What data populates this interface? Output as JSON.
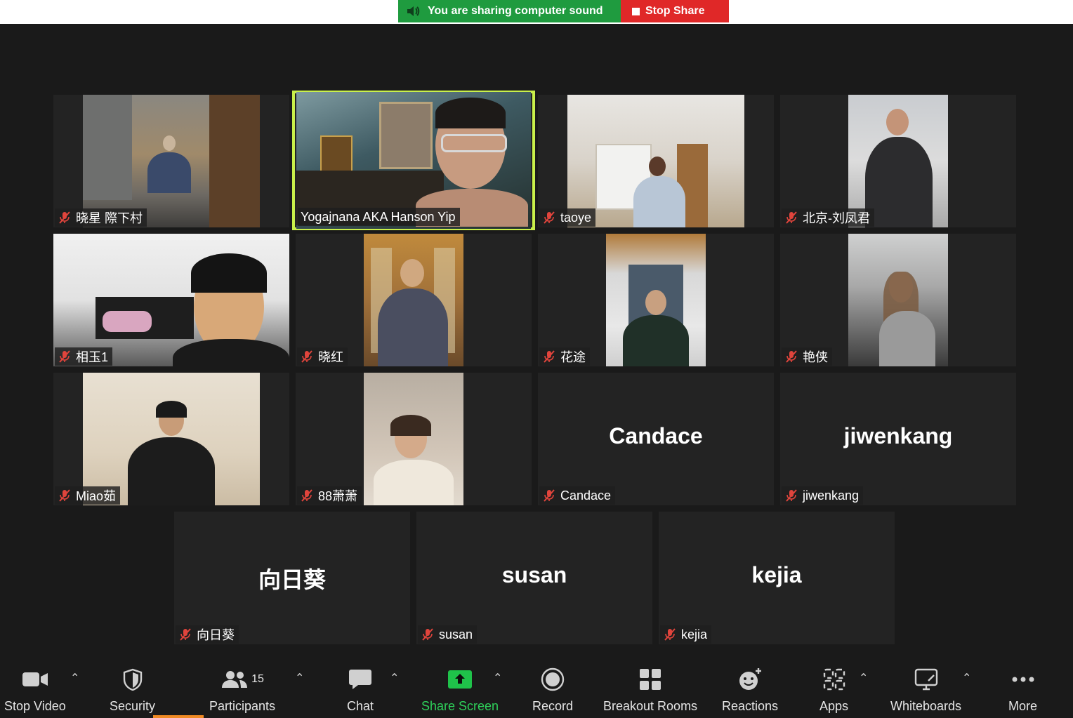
{
  "share_bar": {
    "sound_text": "You are sharing computer sound",
    "stop_text": "Stop Share"
  },
  "tiles": [
    {
      "name": "晓星 際下村",
      "video": true
    },
    {
      "name": "Yogajnana AKA Hanson Yip",
      "video": true,
      "active": true
    },
    {
      "name": "taoye",
      "video": true
    },
    {
      "name": "北京-刘凤君",
      "video": true
    },
    {
      "name": "相玉1",
      "video": true
    },
    {
      "name": "晓红",
      "video": true
    },
    {
      "name": "花途",
      "video": true
    },
    {
      "name": "艳侠",
      "video": true
    },
    {
      "name": "Miao茹",
      "video": true
    },
    {
      "name": "88萧萧",
      "video": true
    },
    {
      "name": "Candace",
      "big_name": "Candace",
      "video": false
    },
    {
      "name": "jiwenkang",
      "big_name": "jiwenkang",
      "video": false
    },
    {
      "name": "向日葵",
      "big_name": "向日葵",
      "video": false
    },
    {
      "name": "susan",
      "big_name": "susan",
      "video": false
    },
    {
      "name": "kejia",
      "big_name": "kejia",
      "video": false
    }
  ],
  "toolbar": {
    "stop_video": "Stop Video",
    "security": "Security",
    "participants": "Participants",
    "participants_count": "15",
    "chat": "Chat",
    "share_screen": "Share Screen",
    "record": "Record",
    "breakout_rooms": "Breakout Rooms",
    "reactions": "Reactions",
    "apps": "Apps",
    "whiteboards": "Whiteboards",
    "more": "More"
  },
  "colors": {
    "share_green": "#1f9b3f",
    "stop_red": "#e02828",
    "active_speaker": "#c9f04a",
    "share_screen_icon": "#1fc24a",
    "mute_icon": "#e0443c"
  }
}
